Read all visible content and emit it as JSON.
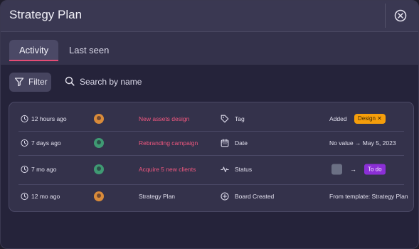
{
  "header": {
    "title": "Strategy Plan"
  },
  "tabs": [
    {
      "label": "Activity"
    },
    {
      "label": "Last seen"
    }
  ],
  "toolbar": {
    "filter_label": "Filter",
    "search_label": "Search by name"
  },
  "rows": [
    {
      "time": "12 hours ago",
      "item": "New assets design",
      "field": "Tag",
      "change": "Added",
      "tag": "Design ✕"
    },
    {
      "time": "7 days ago",
      "item": "Rebranding campaign",
      "field": "Date",
      "change": "No value  → May 5, 2023"
    },
    {
      "time": "7 mo ago",
      "item": "Acquire 5 new clients",
      "field": "Status",
      "arrow": "→",
      "status": "To do"
    },
    {
      "time": "12 mo ago",
      "item": "Strategy Plan",
      "field": "Board Created",
      "change": "From template: Strategy Plan"
    }
  ],
  "colors": {
    "accent": "#e54c75",
    "item_link": "#f0577f",
    "design_tag": "#f59e0b",
    "todo_tag": "#8b2fd6",
    "empty_status": "#6b7084"
  },
  "icons": [
    "close-icon",
    "filter-icon",
    "search-icon",
    "clock-icon",
    "tag-icon",
    "calendar-icon",
    "status-pulse-icon",
    "plus-circle-icon"
  ]
}
